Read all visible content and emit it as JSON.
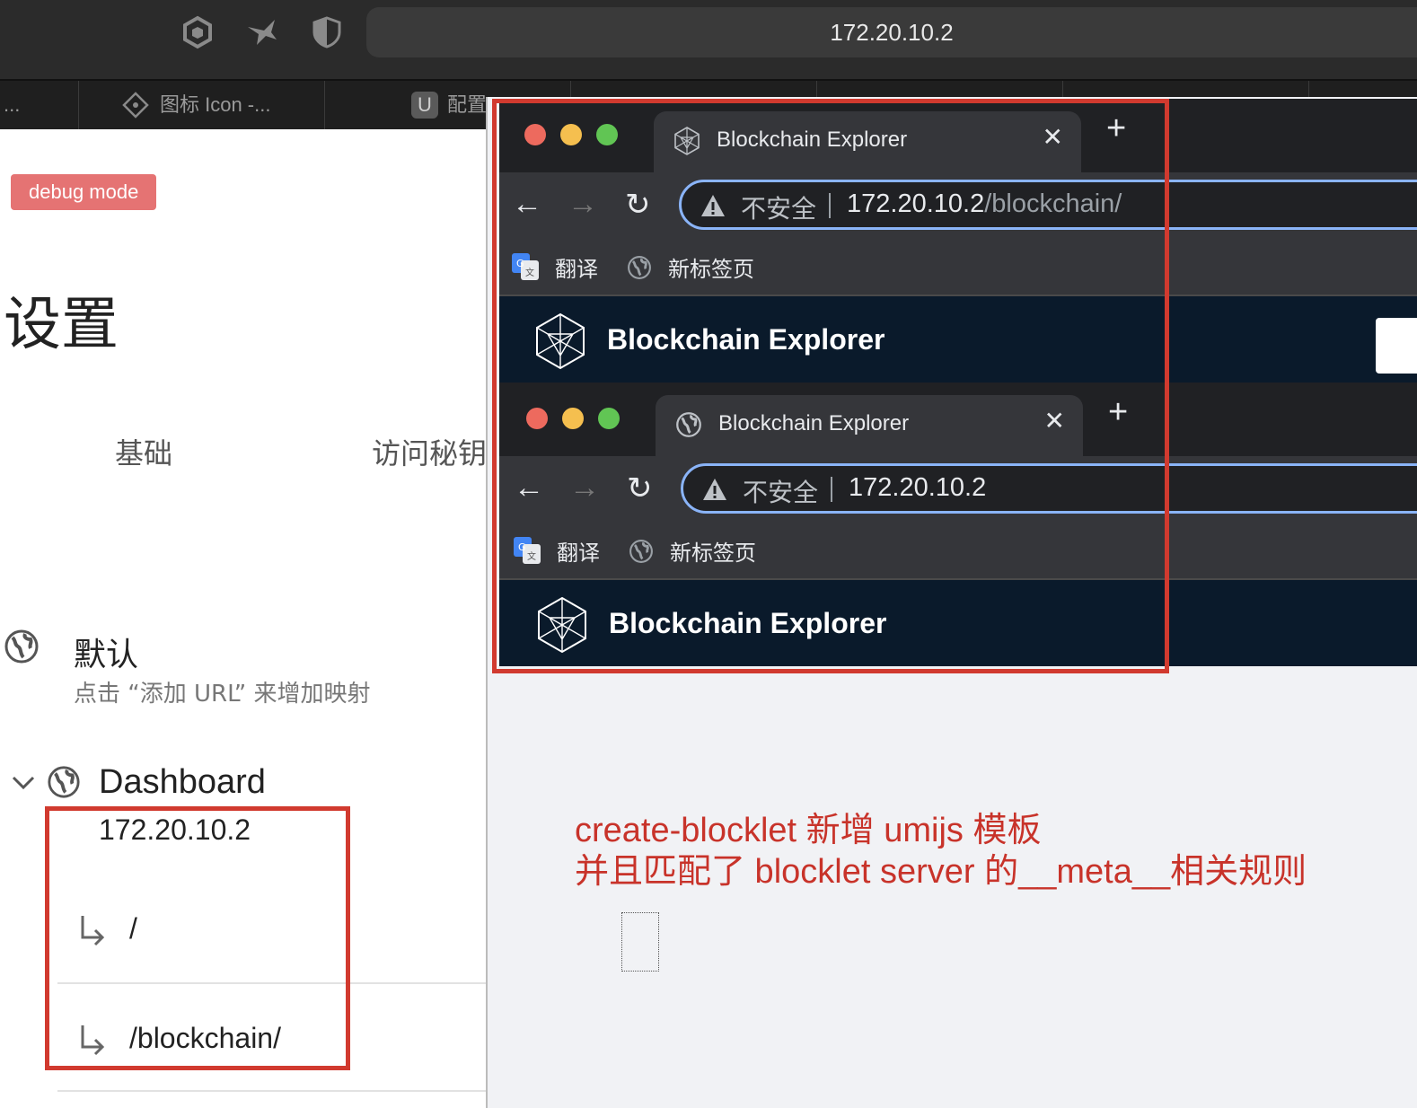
{
  "top_chrome": {
    "url": "172.20.10.2",
    "icons": [
      "cube-icon",
      "bird-icon",
      "shield-icon"
    ],
    "tabs": [
      {
        "label": "..."
      },
      {
        "label": "图标 Icon -..."
      },
      {
        "label": "配置"
      }
    ]
  },
  "settings": {
    "debug_badge": "debug mode",
    "title": "设置",
    "tabs": [
      "基础",
      "访问秘钥"
    ],
    "default_section": {
      "title": "默认",
      "description": "点击 “添加 URL” 来增加映射"
    },
    "dashboard": {
      "title": "Dashboard",
      "host": "172.20.10.2",
      "routes": [
        "/",
        "/blockchain/"
      ]
    }
  },
  "browser_top": {
    "tab_title": "Blockchain Explorer",
    "insecure_label": "不安全",
    "url_host": "172.20.10.2",
    "url_path": "/blockchain/",
    "bookmarks": [
      "翻译",
      "新标签页"
    ],
    "app_title": "Blockchain Explorer"
  },
  "browser_bottom": {
    "tab_title": "Blockchain Explorer",
    "insecure_label": "不安全",
    "url_host": "172.20.10.2",
    "url_path": "",
    "bookmarks": [
      "翻译",
      "新标签页"
    ],
    "app_title": "Blockchain Explorer"
  },
  "annotation": {
    "line1": "create-blocklet 新增 umijs 模板",
    "line2": "并且匹配了 blocklet server 的__meta__相关规则"
  },
  "colors": {
    "highlight_red": "#d13a2f",
    "debug_badge": "#e57373",
    "mac_close": "#ed6a5e",
    "mac_minimize": "#f5bf4f",
    "mac_maximize": "#61c554",
    "omnibox_focus": "#8ab4f8",
    "app_header": "#0a1a2b"
  }
}
